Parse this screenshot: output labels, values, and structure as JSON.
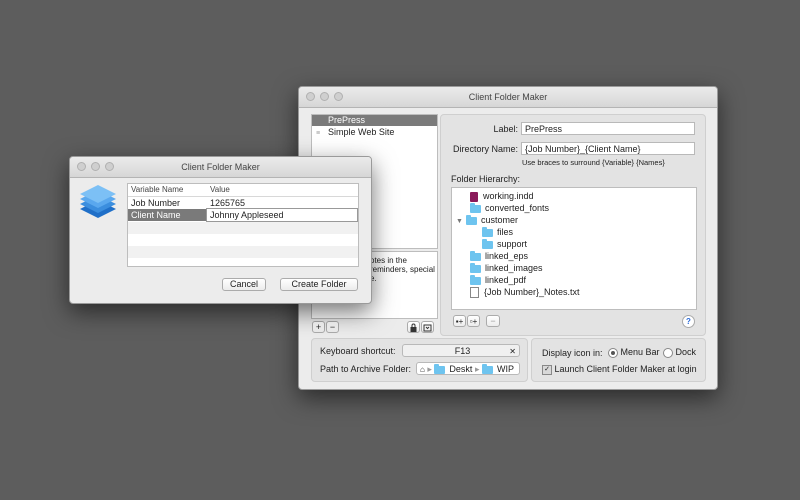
{
  "main_window": {
    "title": "Client Folder Maker",
    "templates": [
      {
        "label": "PrePress",
        "selected": true
      },
      {
        "label": "Simple Web Site",
        "selected": false
      }
    ],
    "notes_fragments": [
      "otes in the",
      "reminders, special",
      "e."
    ],
    "label_caption": "Label:",
    "label_value": "PrePress",
    "directory_caption": "Directory Name:",
    "directory_value": "{Job Number}_{Client Name}",
    "directory_hint": "Use braces to surround {Variable} {Names}",
    "hierarchy_caption": "Folder Hierarchy:",
    "hierarchy": [
      {
        "name": "working.indd",
        "icon": "indesign-file-icon",
        "level": 0
      },
      {
        "name": "converted_fonts",
        "icon": "folder-icon",
        "level": 0
      },
      {
        "name": "customer",
        "icon": "folder-icon",
        "level": 0,
        "expanded": true
      },
      {
        "name": "files",
        "icon": "folder-icon",
        "level": 1
      },
      {
        "name": "support",
        "icon": "folder-icon",
        "level": 1
      },
      {
        "name": "linked_eps",
        "icon": "folder-icon",
        "level": 0
      },
      {
        "name": "linked_images",
        "icon": "folder-icon",
        "level": 0
      },
      {
        "name": "linked_pdf",
        "icon": "folder-icon",
        "level": 0
      },
      {
        "name": "{Job Number}_Notes.txt",
        "icon": "text-file-icon",
        "level": 0
      }
    ],
    "help_label": "?",
    "plus_label": "+",
    "minus_label": "−",
    "shortcut_caption": "Keyboard shortcut:",
    "shortcut_value": "F13",
    "shortcut_clear": "✕",
    "archive_caption": "Path to Archive Folder:",
    "archive_path": [
      "Deskt",
      "WIP"
    ],
    "display_icon_caption": "Display icon in:",
    "display_options": [
      {
        "label": "Menu Bar",
        "selected": true
      },
      {
        "label": "Dock",
        "selected": false
      }
    ],
    "launch_label": "Launch Client Folder Maker at login",
    "launch_checked": true
  },
  "dialog": {
    "title": "Client Folder Maker",
    "col_variable": "Variable Name",
    "col_value": "Value",
    "rows": [
      {
        "name": "Job Number",
        "value": "1265765"
      },
      {
        "name": "Client Name",
        "value": "Johnny Appleseed"
      }
    ],
    "cancel_label": "Cancel",
    "create_label": "Create Folder"
  },
  "colors": {
    "selection": "#7a7a7a",
    "folder": "#6ec4ef",
    "app_icon": "#3b8ede"
  }
}
